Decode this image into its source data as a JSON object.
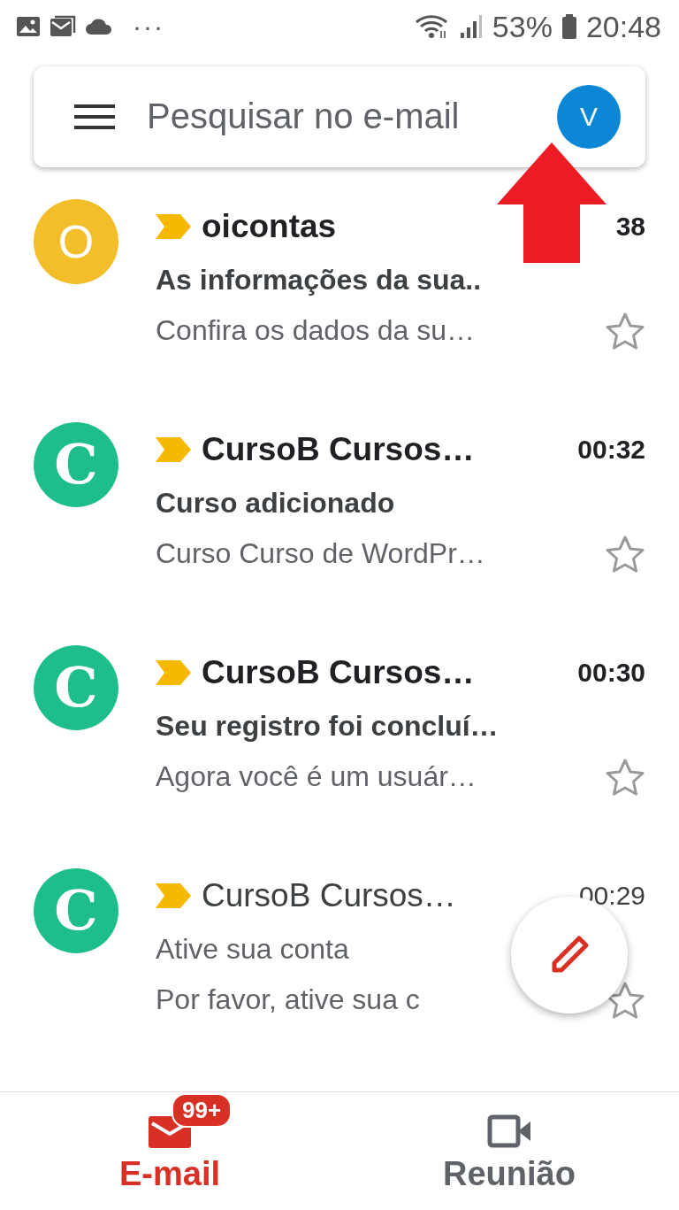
{
  "status_bar": {
    "dots": "···",
    "battery": "53%",
    "time": "20:48"
  },
  "search": {
    "placeholder": "Pesquisar no e-mail",
    "account_initial": "V"
  },
  "emails": [
    {
      "avatar": "O",
      "color": "#f4bd2a",
      "sender": "oicontas",
      "time": "38",
      "subject": "As informações da sua..",
      "snippet": "Confira os dados da su…",
      "unread": true,
      "important": true,
      "starred": false
    },
    {
      "avatar": "C",
      "color": "#1ebd8c",
      "sender": "CursoB Cursos…",
      "time": "00:32",
      "subject": "Curso adicionado",
      "snippet": "Curso Curso de WordPr…",
      "unread": true,
      "important": true,
      "starred": false
    },
    {
      "avatar": "C",
      "color": "#1ebd8c",
      "sender": "CursoB Cursos…",
      "time": "00:30",
      "subject": "Seu registro foi concluí…",
      "snippet": "Agora você é um usuár…",
      "unread": true,
      "important": true,
      "starred": false
    },
    {
      "avatar": "C",
      "color": "#1ebd8c",
      "sender": "CursoB Cursos…",
      "time": "00:29",
      "subject": "Ative sua conta",
      "snippet": "Por favor, ative sua c",
      "unread": false,
      "important": true,
      "starred": false
    }
  ],
  "bottom_nav": [
    {
      "label": "E-mail",
      "badge": "99+",
      "kind": "mail",
      "selected": true
    },
    {
      "label": "Reunião",
      "kind": "video",
      "selected": false
    }
  ]
}
